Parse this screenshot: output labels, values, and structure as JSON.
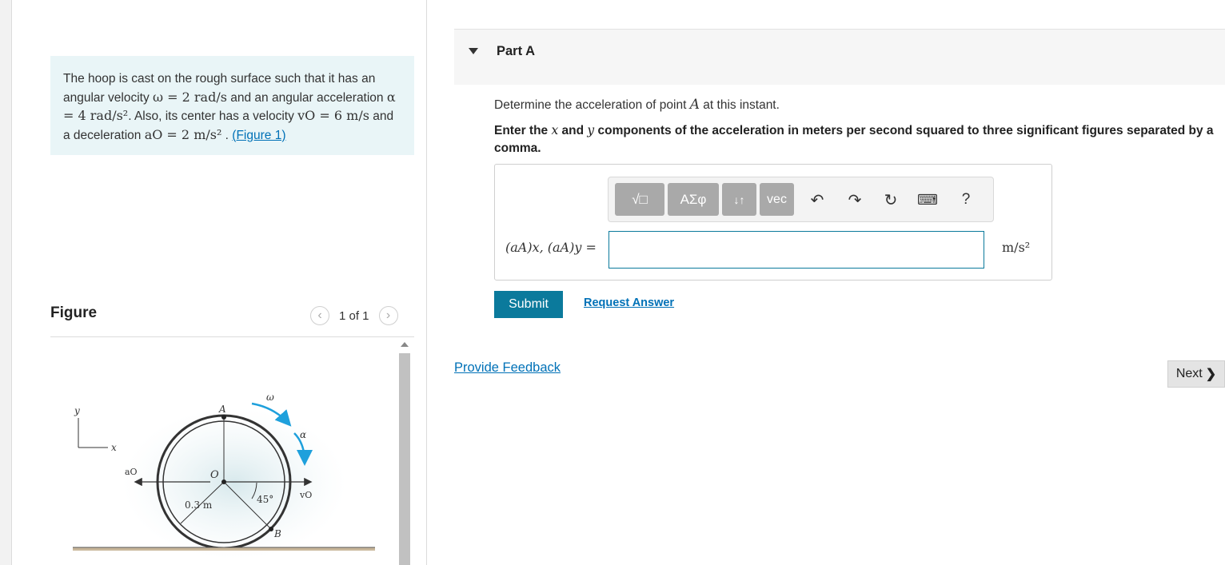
{
  "problem": {
    "t1": "The hoop is cast on the rough surface such that it has an angular velocity ",
    "omega_sym": "ω",
    "omega_val": " = 2 rad/s",
    "t2": " and an angular acceleration ",
    "alpha_sym": "α",
    "alpha_val": " = 4 rad/s²",
    "t3": ". Also, its center has a velocity ",
    "vo_sym": "vO",
    "vo_val": " = 6 m/s",
    "t4": " and a deceleration ",
    "ao_sym": "aO",
    "ao_val": " = 2 m/s²",
    "t5": " . ",
    "figure_link": "(Figure 1)"
  },
  "figure": {
    "title": "Figure",
    "count": "1 of 1",
    "prev_icon": "chevron-left-icon",
    "next_icon": "chevron-right-icon",
    "labels": {
      "y": "y",
      "x": "x",
      "A": "A",
      "omega": "ω",
      "alpha": "α",
      "ao": "aO",
      "O": "O",
      "vo": "vO",
      "radius": "0.3 m",
      "angle": "45°",
      "B": "B"
    }
  },
  "part": {
    "title": "Part A",
    "question_pre": "Determine the acceleration of point ",
    "question_sym": "A",
    "question_post": " at this instant.",
    "instr_1": "Enter the ",
    "instr_x": "x",
    "instr_2": " and ",
    "instr_y": "y",
    "instr_3": " components of the acceleration in meters per second squared to three significant figures separated by a comma."
  },
  "toolbar": {
    "templates": "√□",
    "symbols": "ΑΣφ",
    "arrows": "↓↑",
    "vec": "vec",
    "undo_icon": "undo-icon",
    "redo_icon": "redo-icon",
    "reset_icon": "reset-icon",
    "keyboard_icon": "keyboard-icon",
    "help": "?"
  },
  "answer": {
    "label": "(aA)x, (aA)y =",
    "value": "",
    "unit": "m/s²"
  },
  "actions": {
    "submit": "Submit",
    "request": "Request Answer",
    "feedback": "Provide Feedback",
    "next": "Next"
  },
  "colors": {
    "accent": "#0b7a9c",
    "link": "#0071b7",
    "problem_bg": "#e9f5f7",
    "arrow_blue": "#1ea0dc"
  }
}
